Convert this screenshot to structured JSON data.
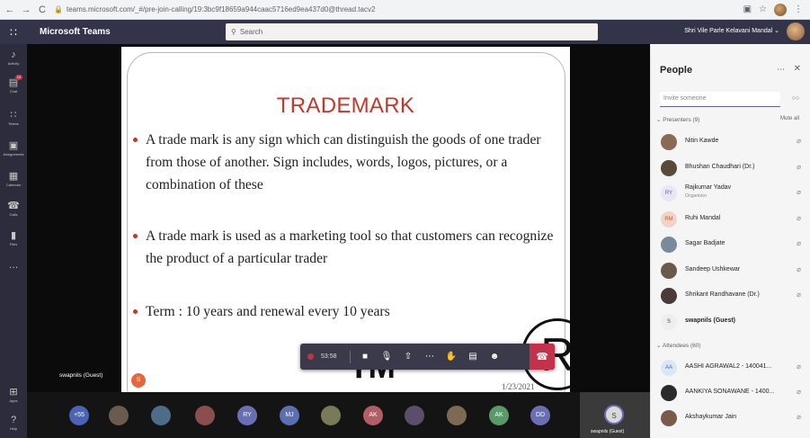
{
  "browser": {
    "url": "teams.microsoft.com/_#/pre-join-calling/19:3bc9f18659a944caac5716ed9ea437d0@thread.tacv2",
    "back_icon": "←",
    "forward_icon": "→",
    "reload_icon": "C"
  },
  "teams": {
    "app_name": "Microsoft Teams",
    "search_placeholder": "Search",
    "user_name": "Shri Vile Parle Kelavani Mandal"
  },
  "rail": [
    {
      "icon": "bell-icon",
      "glyph": "♪",
      "label": "Activity"
    },
    {
      "icon": "chat-icon",
      "glyph": "▤",
      "label": "Chat",
      "badge": "10"
    },
    {
      "icon": "teams-icon",
      "glyph": "∷",
      "label": "Teams"
    },
    {
      "icon": "assignments-icon",
      "glyph": "▣",
      "label": "Assignments"
    },
    {
      "icon": "calendar-icon",
      "glyph": "▦",
      "label": "Calendar"
    },
    {
      "icon": "calls-icon",
      "glyph": "☎",
      "label": "Calls"
    },
    {
      "icon": "files-icon",
      "glyph": "▮",
      "label": "Files"
    },
    {
      "icon": "more-icon",
      "glyph": "…",
      "label": ""
    },
    {
      "icon": "apps-icon",
      "glyph": "⊞",
      "label": "Apps"
    },
    {
      "icon": "help-icon",
      "glyph": "?",
      "label": "Help"
    }
  ],
  "slide": {
    "title": "TRADEMARK",
    "bullets": [
      "A trade mark is any sign which can distinguish the goods of one trader from those of another. Sign includes, words, logos, pictures, or a combination of these",
      "A trade mark is used as a marketing tool so that customers can recognize the product of a particular trader",
      "Term : 10 years and renewal every 10 years"
    ],
    "tm_text": "TM",
    "r_text": "R",
    "date": "1/23/2021"
  },
  "self_view_label": "swapnils (Guest)",
  "self_avatar_initial": "S",
  "call": {
    "duration": "53:58"
  },
  "strip": {
    "overflow_count": "+55",
    "participants": [
      {
        "initials": "",
        "color": "#6b5a4e"
      },
      {
        "initials": "",
        "color": "#4f6b8a"
      },
      {
        "initials": "",
        "color": "#8a4e4e"
      },
      {
        "initials": "RY",
        "color": "#6a6fb4"
      },
      {
        "initials": "MJ",
        "color": "#5c6fb0"
      },
      {
        "initials": "",
        "color": "#7a7a5a"
      },
      {
        "initials": "AK",
        "color": "#b15e66"
      },
      {
        "initials": "",
        "color": "#5a4e6b"
      },
      {
        "initials": "",
        "color": "#7d6a55"
      },
      {
        "initials": "AK",
        "color": "#5a9a6a"
      },
      {
        "initials": "DD",
        "color": "#6a6fb4"
      }
    ],
    "self_tile_initial": "S",
    "self_tile_name": "swapnils (Guest)"
  },
  "people": {
    "title": "People",
    "invite_placeholder": "Invite someone",
    "presenters_label": "Presenters (9)",
    "mute_all": "Mute all",
    "attendees_label": "Attendees (60)",
    "presenters": [
      {
        "name": "Nitin Kawde",
        "initials": "",
        "color": "#8a6a55"
      },
      {
        "name": "Bhushan Chaudhari (Dr.)",
        "initials": "",
        "color": "#5a4a3a"
      },
      {
        "name": "Rajkumar Yadav",
        "sub": "Organizer",
        "initials": "RY",
        "color": "#e9e6f5",
        "fg": "#6264a7"
      },
      {
        "name": "Ruhi Mandal",
        "initials": "RM",
        "color": "#f3d3c8",
        "fg": "#b15e3e"
      },
      {
        "name": "Sagar Badjate",
        "initials": "",
        "color": "#7a8a9a"
      },
      {
        "name": "Sandeep Ushkewar",
        "initials": "",
        "color": "#6b5a4a"
      },
      {
        "name": "Shrikant Randhavane (Dr.)",
        "initials": "",
        "color": "#4a3a3a"
      },
      {
        "name": "swapnils (Guest)",
        "initials": "S",
        "color": "#eeeeee",
        "fg": "#444",
        "bold": true
      }
    ],
    "attendees": [
      {
        "name": "AASHI AGRAWAL2 - 140041...",
        "initials": "AA",
        "color": "#dbe7f5",
        "fg": "#3a6fb0"
      },
      {
        "name": "AANKIYA SONAWANE - 1400...",
        "initials": "",
        "color": "#2a2a2a"
      },
      {
        "name": "Akshaykumar Jain",
        "initials": "",
        "color": "#7a5a4a"
      }
    ]
  }
}
